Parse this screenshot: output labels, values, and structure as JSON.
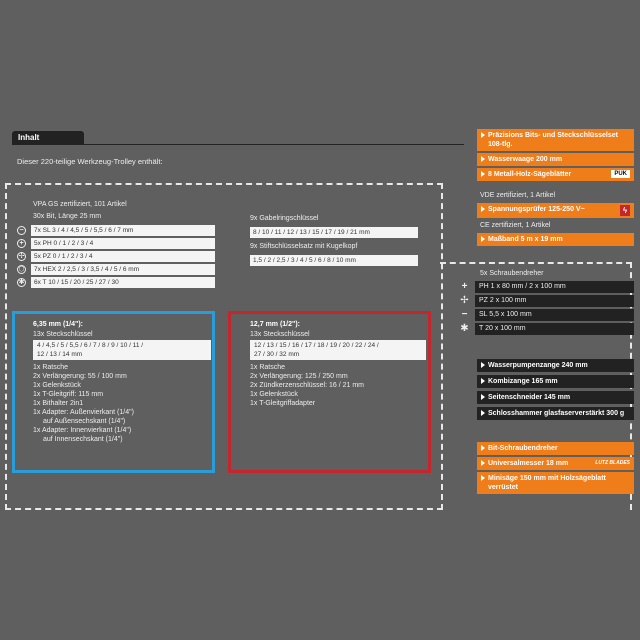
{
  "header": {
    "tab": "Inhalt",
    "intro": "Dieser 220-teilige Werkzeug-Trolley enthält:"
  },
  "vpa": {
    "title": "VPA GS zertifiziert, 101 Artikel",
    "bits_title": "30x Bit, Länge 25 mm",
    "bits": [
      {
        "icon": "slot-icon",
        "glyph": "−",
        "text": "7x SL 3 / 4 / 4,5 / 5 / 5,5 / 6 / 7 mm"
      },
      {
        "icon": "phillips-icon",
        "glyph": "+",
        "text": "5x PH 0 / 1 / 2 / 3 / 4"
      },
      {
        "icon": "pozidriv-icon",
        "glyph": "✢",
        "text": "5x PZ 0 / 1 / 2 / 3 / 4"
      },
      {
        "icon": "hex-icon",
        "glyph": "⬡",
        "text": "7x HEX 2 / 2,5 / 3 / 3,5 / 4 / 5 / 6 mm"
      },
      {
        "icon": "torx-icon",
        "glyph": "✱",
        "text": "6x T 10 / 15 / 20 / 25 / 27 / 30"
      }
    ],
    "gabel_title": "9x Gabelringschlüssel",
    "gabel_values": "8 / 10 / 11 / 12 / 13 / 15 / 17 / 19 / 21 mm",
    "stift_title": "9x Stiftschlüsselsatz mit Kugelkopf",
    "stift_values": "1,5 / 2 / 2,5 / 3 / 4 / 5 / 6 / 8 / 10 mm"
  },
  "blue": {
    "title": "6,35 mm (1/4\"):",
    "sub": "13x Steckschlüssel",
    "box_line1": "4 / 4,5 / 5 / 5,5 / 6 / 7 / 8 / 9 / 10 / 11 /",
    "box_line2": "12 / 13 / 14 mm",
    "items": [
      "1x Ratsche",
      "2x Verlängerung: 55 / 100 mm",
      "1x Gelenkstück",
      "1x T-Gleitgriff: 115 mm",
      "1x Bithalter 2in1",
      "1x Adapter: Außenvierkant (1/4\")",
      "auf Außensechskant (1/4\")",
      "1x Adapter: Innenvierkant (1/4\")",
      "auf Innensechskant (1/4\")"
    ]
  },
  "red": {
    "title": "12,7 mm (1/2\"):",
    "sub": "13x Steckschlüssel",
    "box_line1": "12 / 13 / 15 / 16 / 17 / 18 / 19 / 20 / 22 / 24 /",
    "box_line2": "27 / 30 / 32 mm",
    "items": [
      "1x Ratsche",
      "2x Verlängerung: 125 / 250 mm",
      "2x Zündkerzenschlüssel: 16 / 21 mm",
      "1x Gelenkstück",
      "1x T-Gleitgriffadapter"
    ]
  },
  "right": {
    "orange_top": [
      "Präzisions Bits- und Steckschlüsselset 108-tlg.",
      "Wasserwaage 200 mm",
      "8 Metall-Holz-Sägeblätter"
    ],
    "puk_logo": "PUK",
    "vde_title": "VDE zertifiziert, 1 Artikel",
    "vde_item": "Spannungsprüfer 125-250 V~",
    "ce_title": "CE zertifiziert, 1 Artikel",
    "ce_item": "Maßband 5 m x 19 mm",
    "screw_title": "5x Schraubendreher",
    "screw_rows": [
      {
        "icon": "phillips-icon",
        "glyph": "+",
        "text": "PH 1 x 80 mm / 2 x 100 mm"
      },
      {
        "icon": "pozidriv-icon",
        "glyph": "✢",
        "text": "PZ 2 x 100 mm"
      },
      {
        "icon": "slot-icon",
        "glyph": "−",
        "text": "SL 5,5 x 100 mm"
      },
      {
        "icon": "torx-icon",
        "glyph": "✱",
        "text": "T 20 x 100 mm"
      }
    ],
    "black_items": [
      "Wasserpumpenzange 240 mm",
      "Kombizange 165 mm",
      "Seitenschneider 145 mm",
      "Schlosshammer glasfaserverstärkt 300 g"
    ],
    "orange_bottom": [
      "Bit-Schraubendreher",
      "Universalmesser 18 mm",
      "Minisäge 150 mm mit Holzsägeblatt verrüstet"
    ],
    "lutz_logo": "LUTZ BLADES"
  },
  "colors": {
    "orange": "#ee7d1a",
    "blue": "#2a9cd8",
    "red": "#c4262e",
    "dark": "#222222",
    "bg": "#5f5f5f"
  }
}
